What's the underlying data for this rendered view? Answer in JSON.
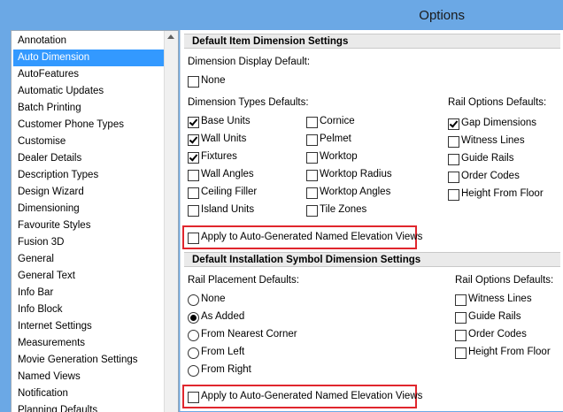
{
  "window": {
    "title": "Options"
  },
  "sidebar": {
    "items": [
      {
        "label": "Annotation"
      },
      {
        "label": "Auto Dimension",
        "selected": true
      },
      {
        "label": "AutoFeatures"
      },
      {
        "label": "Automatic Updates"
      },
      {
        "label": "Batch Printing"
      },
      {
        "label": "Customer Phone Types"
      },
      {
        "label": "Customise"
      },
      {
        "label": "Dealer Details"
      },
      {
        "label": "Description Types"
      },
      {
        "label": "Design Wizard"
      },
      {
        "label": "Dimensioning"
      },
      {
        "label": "Favourite Styles"
      },
      {
        "label": "Fusion 3D"
      },
      {
        "label": "General"
      },
      {
        "label": "General Text"
      },
      {
        "label": "Info Bar"
      },
      {
        "label": "Info Block"
      },
      {
        "label": "Internet Settings"
      },
      {
        "label": "Measurements"
      },
      {
        "label": "Movie Generation Settings"
      },
      {
        "label": "Named Views"
      },
      {
        "label": "Notification"
      },
      {
        "label": "Planning Defaults"
      }
    ]
  },
  "item_dim": {
    "header": "Default Item Dimension Settings",
    "display_default": {
      "label": "Dimension Display Default:",
      "none": {
        "label": "None",
        "checked": false
      }
    },
    "types_label": "Dimension Types Defaults:",
    "types_col1": [
      {
        "label": "Base Units",
        "checked": true
      },
      {
        "label": "Wall Units",
        "checked": true
      },
      {
        "label": "Fixtures",
        "checked": true
      },
      {
        "label": "Wall Angles",
        "checked": false
      },
      {
        "label": "Ceiling Filler",
        "checked": false
      },
      {
        "label": "Island Units",
        "checked": false
      }
    ],
    "types_col2": [
      {
        "label": "Cornice",
        "checked": false
      },
      {
        "label": "Pelmet",
        "checked": false
      },
      {
        "label": "Worktop",
        "checked": false
      },
      {
        "label": "Worktop Radius",
        "checked": false
      },
      {
        "label": "Worktop Angles",
        "checked": false
      },
      {
        "label": "Tile Zones",
        "checked": false
      }
    ],
    "rail_label": "Rail Options Defaults:",
    "rail_options": [
      {
        "label": "Gap Dimensions",
        "checked": true
      },
      {
        "label": "Witness Lines",
        "checked": false
      },
      {
        "label": "Guide Rails",
        "checked": false
      },
      {
        "label": "Order Codes",
        "checked": false
      },
      {
        "label": "Height From Floor",
        "checked": false
      }
    ],
    "apply": {
      "label": "Apply to Auto-Generated Named Elevation Views",
      "checked": false
    }
  },
  "install_dim": {
    "header": "Default Installation Symbol Dimension Settings",
    "placement_label": "Rail Placement Defaults:",
    "placement": [
      {
        "label": "None",
        "checked": false
      },
      {
        "label": "As Added",
        "checked": true
      },
      {
        "label": "From Nearest Corner",
        "checked": false
      },
      {
        "label": "From Left",
        "checked": false
      },
      {
        "label": "From Right",
        "checked": false
      }
    ],
    "rail_label": "Rail Options Defaults:",
    "rail_options": [
      {
        "label": "Witness Lines",
        "checked": false
      },
      {
        "label": "Guide Rails",
        "checked": false
      },
      {
        "label": "Order Codes",
        "checked": false
      },
      {
        "label": "Height From Floor",
        "checked": false
      }
    ],
    "apply": {
      "label": "Apply to Auto-Generated Named Elevation Views",
      "checked": false
    }
  },
  "colors": {
    "titlebar": "#6ba8e5",
    "selection": "#3399ff",
    "highlight_box": "#e0262d"
  }
}
